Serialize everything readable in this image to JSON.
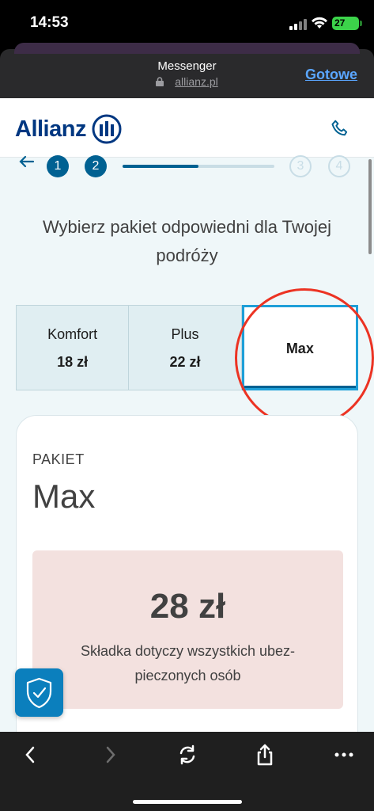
{
  "status_bar": {
    "time": "14:53",
    "battery": "27"
  },
  "browser": {
    "title": "Messenger",
    "url": "allianz.pl",
    "done_label": "Gotowe"
  },
  "site": {
    "logo_text": "Allianz"
  },
  "stepper": {
    "steps": [
      "1",
      "2",
      "3",
      "4"
    ],
    "current_step": 2,
    "progress": 0.5
  },
  "headline": "Wybierz pakiet odpowiedni dla Twojej podróży",
  "packages": [
    {
      "name": "Komfort",
      "price": "18 zł"
    },
    {
      "name": "Plus",
      "price": "22 zł"
    },
    {
      "name": "Max"
    }
  ],
  "card": {
    "label": "PAKIET",
    "title": "Max",
    "price": "28 zł",
    "price_desc": "Składka dotyczy wszystkich ubez-pieczonych osób"
  },
  "colors": {
    "brand": "#003781",
    "accent": "#006192",
    "highlight": "#ec3323"
  },
  "icons": [
    "back-arrow-icon",
    "phone-icon",
    "shield-check-icon",
    "chevron-left-icon",
    "chevron-right-icon",
    "refresh-icon",
    "share-icon",
    "more-icon",
    "lock-icon",
    "wifi-icon",
    "signal-icon"
  ]
}
